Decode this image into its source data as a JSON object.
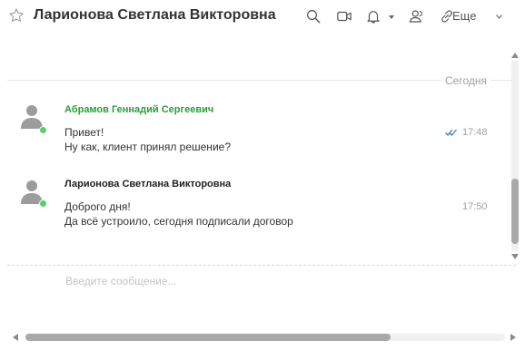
{
  "header": {
    "title": "Ларионова Светлана Викторовна",
    "more_label": "Еще"
  },
  "chat": {
    "date_separator": "Сегодня",
    "messages": [
      {
        "author": "Абрамов Геннадий Сергеевич",
        "lines": [
          "Привет!",
          "Ну как, клиент принял решение?"
        ],
        "time": "17:48",
        "read": true
      },
      {
        "author": "Ларионова Светлана Викторовна",
        "lines": [
          "Доброго дня!",
          "Да всё устроило, сегодня подписали договор"
        ],
        "time": "17:50",
        "read": false
      }
    ]
  },
  "composer": {
    "placeholder": "Введите сообщение..."
  },
  "colors": {
    "author_accent": "#2a9c3c",
    "online": "#55d16a",
    "check": "#3b7ecf"
  },
  "icons": [
    "star-icon",
    "search-icon",
    "video-icon",
    "bell-icon",
    "users-icon",
    "link-icon",
    "avatar-icon"
  ]
}
